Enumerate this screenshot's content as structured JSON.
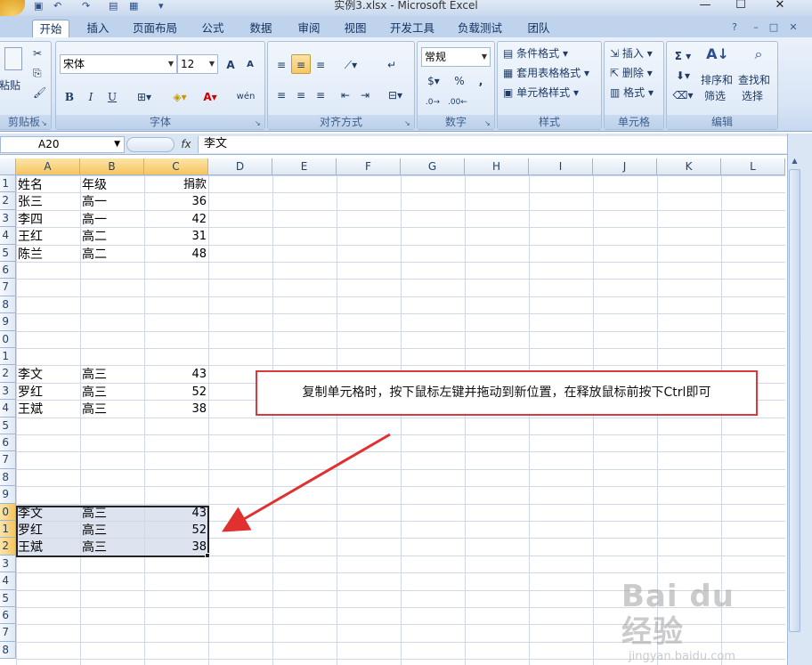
{
  "window": {
    "title": "实例3.xlsx - Microsoft Excel",
    "minimize": "—",
    "maximize": "☐",
    "close": "✕"
  },
  "tabs": [
    {
      "label": "开始",
      "active": true
    },
    {
      "label": "插入"
    },
    {
      "label": "页面布局"
    },
    {
      "label": "公式"
    },
    {
      "label": "数据"
    },
    {
      "label": "审阅"
    },
    {
      "label": "视图"
    },
    {
      "label": "开发工具"
    },
    {
      "label": "负载测试"
    },
    {
      "label": "团队"
    }
  ],
  "ribbon": {
    "clipboard": {
      "label": "剪贴板",
      "paste": "粘贴"
    },
    "font": {
      "label": "字体",
      "font_name": "宋体",
      "font_size": "12",
      "bold": "B",
      "italic": "I",
      "underline": "U",
      "grow": "A",
      "shrink": "A",
      "font_color_glyph": "A",
      "phonetic": "wén"
    },
    "alignment": {
      "label": "对齐方式"
    },
    "number": {
      "label": "数字",
      "format": "常规",
      "percent": "%",
      "comma": ","
    },
    "styles": {
      "label": "样式",
      "conditional": "条件格式",
      "table": "套用表格格式",
      "cell_styles": "单元格样式"
    },
    "cells": {
      "label": "单元格",
      "insert": "插入",
      "delete": "删除",
      "format": "格式"
    },
    "editing": {
      "label": "编辑",
      "sum_glyph": "Σ",
      "sort_filter_1": "排序和",
      "sort_filter_2": "筛选",
      "find_select_1": "查找和",
      "find_select_2": "选择"
    }
  },
  "formula_bar": {
    "name_box": "A20",
    "fx": "fx",
    "content": "李文"
  },
  "sheet": {
    "columns": [
      "A",
      "B",
      "C",
      "D",
      "E",
      "F",
      "G",
      "H",
      "I",
      "J",
      "K",
      "L"
    ],
    "row_numbers": [
      "1",
      "2",
      "3",
      "4",
      "5",
      "6",
      "7",
      "8",
      "9",
      "0",
      "1",
      "2",
      "3",
      "4",
      "5",
      "6",
      "7",
      "8",
      "9",
      "0",
      "1",
      "2",
      "3",
      "4",
      "5",
      "6",
      "7",
      "8"
    ],
    "rows": [
      {
        "a": "姓名",
        "b": "年级",
        "c": "捐款"
      },
      {
        "a": "张三",
        "b": "高一",
        "c": "36"
      },
      {
        "a": "李四",
        "b": "高一",
        "c": "42"
      },
      {
        "a": "王红",
        "b": "高二",
        "c": "31"
      },
      {
        "a": "陈兰",
        "b": "高二",
        "c": "48"
      },
      {
        "a": "",
        "b": "",
        "c": ""
      },
      {
        "a": "",
        "b": "",
        "c": ""
      },
      {
        "a": "",
        "b": "",
        "c": ""
      },
      {
        "a": "",
        "b": "",
        "c": ""
      },
      {
        "a": "",
        "b": "",
        "c": ""
      },
      {
        "a": "",
        "b": "",
        "c": ""
      },
      {
        "a": "李文",
        "b": "高三",
        "c": "43"
      },
      {
        "a": "罗红",
        "b": "高三",
        "c": "52"
      },
      {
        "a": "王斌",
        "b": "高三",
        "c": "38"
      },
      {
        "a": "",
        "b": "",
        "c": ""
      },
      {
        "a": "",
        "b": "",
        "c": ""
      },
      {
        "a": "",
        "b": "",
        "c": ""
      },
      {
        "a": "",
        "b": "",
        "c": ""
      },
      {
        "a": "",
        "b": "",
        "c": ""
      },
      {
        "a": "李文",
        "b": "高三",
        "c": "43"
      },
      {
        "a": "罗红",
        "b": "高三",
        "c": "52"
      },
      {
        "a": "王斌",
        "b": "高三",
        "c": "38"
      },
      {
        "a": "",
        "b": "",
        "c": ""
      },
      {
        "a": "",
        "b": "",
        "c": ""
      },
      {
        "a": "",
        "b": "",
        "c": ""
      },
      {
        "a": "",
        "b": "",
        "c": ""
      },
      {
        "a": "",
        "b": "",
        "c": ""
      },
      {
        "a": "",
        "b": "",
        "c": ""
      }
    ],
    "selected_rows": [
      20,
      21,
      22
    ]
  },
  "annotation": {
    "callout": "复制单元格时，按下鼠标左键并拖动到新位置，在释放鼠标前按下Ctrl即可",
    "arrow_color": "#e03030",
    "border_color": "#d93a3a"
  },
  "watermark": {
    "brand": "Bai du 经验",
    "url": "jingyan.baidu.com"
  },
  "colors": {
    "ribbon_bg": "#dbe6f4",
    "header_selected": "#f7c45e",
    "selection_fill": "#dde4f0"
  }
}
